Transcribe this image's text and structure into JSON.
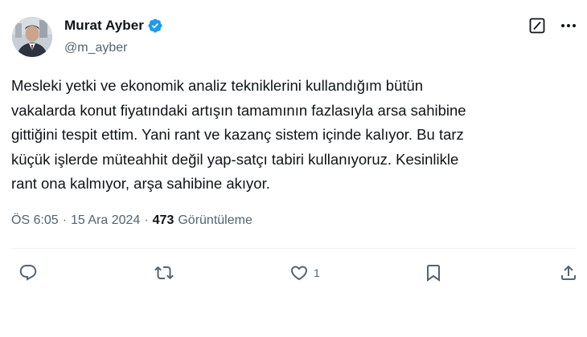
{
  "author": {
    "display_name": "Murat Ayber",
    "handle": "@m_ayber",
    "verified": true,
    "avatar": "profile-photo"
  },
  "post": {
    "text": "Mesleki yetki ve ekonomik analiz tekniklerini kullandığım bütün\nvakalarda konut fiyatındaki artışın tamamının fazlasıyla arsa sahibine\ngittiğini tespit ettim. Yani rant ve kazanç sistem içinde kalıyor. Bu tarz\nküçük işlerde müteahhit değil yap-satçı tabiri kullanıyoruz. Kesinlikle\nrant ona kalmıyor, arşa sahibine akıyor."
  },
  "meta": {
    "time": "ÖS 6:05",
    "separator": "·",
    "date": "15 Ara 2024",
    "views_count": "473",
    "views_label": "Görüntüleme"
  },
  "actions": {
    "reply": {
      "icon": "reply-icon",
      "count": ""
    },
    "repost": {
      "icon": "repost-icon",
      "count": ""
    },
    "like": {
      "icon": "heart-icon",
      "count": "1"
    },
    "bookmark": {
      "icon": "bookmark-icon",
      "count": ""
    },
    "share": {
      "icon": "share-icon",
      "count": ""
    }
  },
  "colors": {
    "text": "#0f1419",
    "secondary": "#536471",
    "verified_badge": "#1d9bf0",
    "divider": "#eff3f4"
  }
}
